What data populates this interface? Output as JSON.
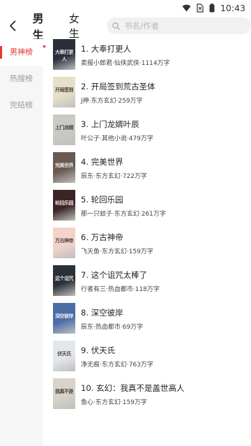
{
  "status_bar": {
    "time": "10:43"
  },
  "header": {
    "tabs": [
      {
        "label": "男生",
        "active": true
      },
      {
        "label": "女生",
        "active": false
      }
    ],
    "search_placeholder": "书名/作者"
  },
  "sidebar": {
    "items": [
      {
        "label": "男神榜",
        "active": true
      },
      {
        "label": "热搜榜",
        "active": false
      },
      {
        "label": "完结榜",
        "active": false
      }
    ]
  },
  "books": [
    {
      "title": "1. 大奉打更人",
      "meta": "卖报小郎君·仙侠武侠·1114万字",
      "cover_color": "#2b2f3a",
      "cover_text": "大奉打更人"
    },
    {
      "title": "2. 开局签到荒古圣体",
      "meta": "J神·东方玄幻·259万字",
      "cover_color": "#e6e0c8",
      "cover_text": "开局签到",
      "cover_light": true
    },
    {
      "title": "3. 上门龙婿叶辰",
      "meta": "叶公子·其他小说·479万字",
      "cover_color": "#c9c9c5",
      "cover_text": "上门龙婿",
      "cover_light": true
    },
    {
      "title": "4. 完美世界",
      "meta": "辰东·东方玄幻·722万字",
      "cover_color": "#6a5a52",
      "cover_text": "完美世界"
    },
    {
      "title": "5. 轮回乐园",
      "meta": "那一只蚊子·东方玄幻·261万字",
      "cover_color": "#3a2424",
      "cover_text": "轮回乐园"
    },
    {
      "title": "6. 万古神帝",
      "meta": "飞天鱼·东方玄幻·159万字",
      "cover_color": "#f3d3cb",
      "cover_text": "万古神帝",
      "cover_light": true
    },
    {
      "title": "7. 这个诅咒太棒了",
      "meta": "行者有三·热血都市·118万字",
      "cover_color": "#2a3138",
      "cover_text": "这个诅咒"
    },
    {
      "title": "8. 深空彼岸",
      "meta": "辰东·热血都市·69万字",
      "cover_color": "#4a6ea8",
      "cover_text": "深空彼岸"
    },
    {
      "title": "9. 伏天氏",
      "meta": "净无痕·东方玄幻·763万字",
      "cover_color": "#e3e6ea",
      "cover_text": "伏天氏",
      "cover_light": true
    },
    {
      "title": "10. 玄幻：我真不是盖世高人",
      "meta": "鱼心·东方玄幻·159万字",
      "cover_color": "#d8d2c8",
      "cover_text": "我真不是",
      "cover_light": true
    }
  ]
}
